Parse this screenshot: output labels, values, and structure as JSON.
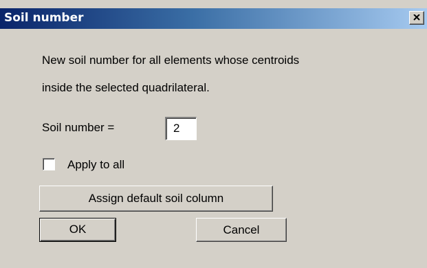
{
  "dialog": {
    "title": "Soil number",
    "close_icon": "close-x-icon",
    "description_line1": "New soil number for all elements whose centroids",
    "description_line2": "inside the selected quadrilateral.",
    "soil_number_label": "Soil number =",
    "soil_number_value": "2",
    "apply_to_all_label": "Apply to all",
    "apply_to_all_checked": false,
    "assign_default_label": "Assign default soil column",
    "ok_label": "OK",
    "cancel_label": "Cancel"
  },
  "colors": {
    "face": "#d4d0c8",
    "title_start": "#0a246a",
    "title_end": "#a6caf0"
  }
}
